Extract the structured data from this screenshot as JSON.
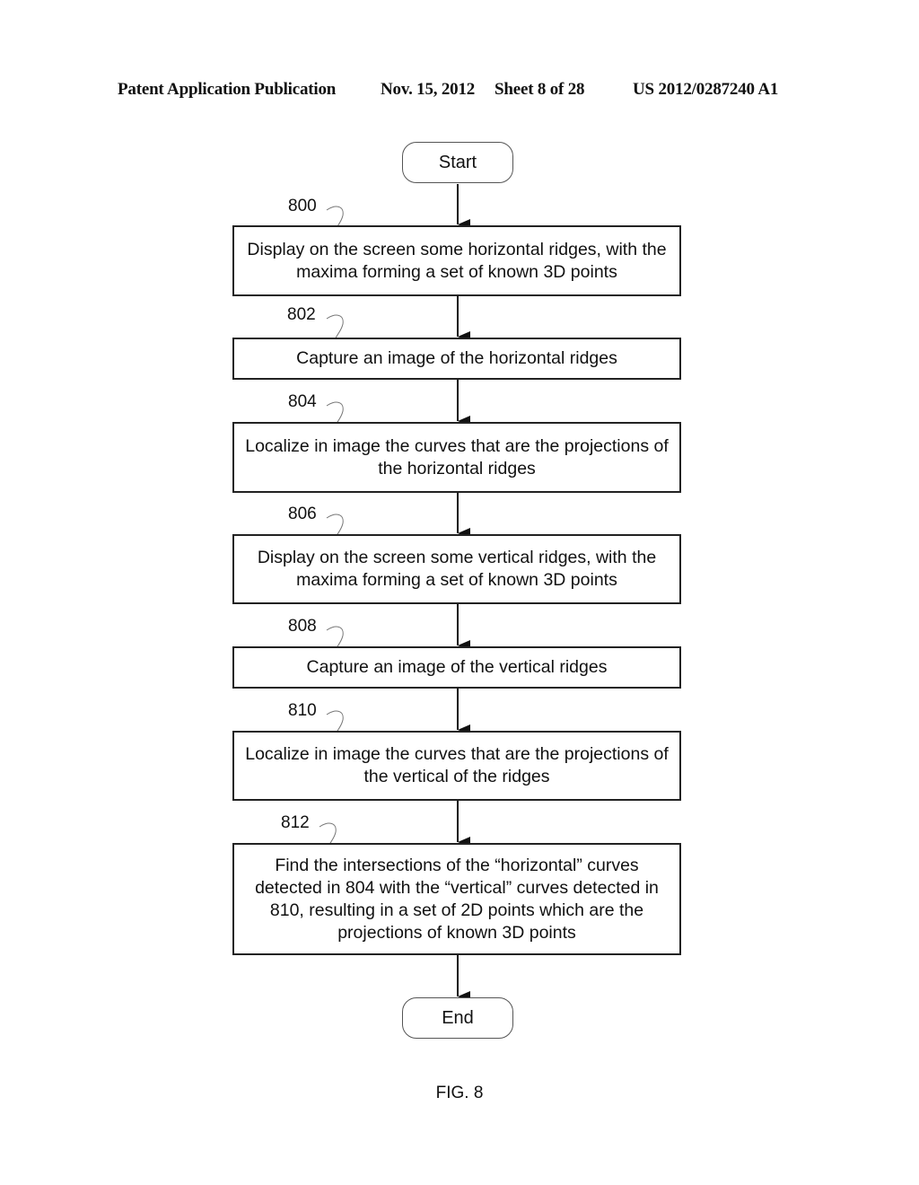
{
  "header": {
    "publication": "Patent Application Publication",
    "date": "Nov. 15, 2012",
    "sheet": "Sheet 8 of 28",
    "number": "US 2012/0287240 A1"
  },
  "flowchart": {
    "start_label": "Start",
    "end_label": "End",
    "steps": [
      {
        "ref": "800",
        "text": "Display on the screen some horizontal ridges, with the maxima forming a set of known 3D points"
      },
      {
        "ref": "802",
        "text": "Capture an image of the horizontal ridges"
      },
      {
        "ref": "804",
        "text": "Localize in image the curves that are the projections of the horizontal ridges"
      },
      {
        "ref": "806",
        "text": "Display on the screen some vertical ridges, with the maxima forming a set of known 3D points"
      },
      {
        "ref": "808",
        "text": "Capture an image of the vertical ridges"
      },
      {
        "ref": "810",
        "text": "Localize in image the curves that are the projections of the vertical of the ridges"
      },
      {
        "ref": "812",
        "text": "Find the intersections of the “horizontal” curves detected in 804 with the “vertical” curves detected in 810, resulting in a set of 2D points which are the projections of known 3D points"
      }
    ]
  },
  "figure_label": "FIG. 8"
}
